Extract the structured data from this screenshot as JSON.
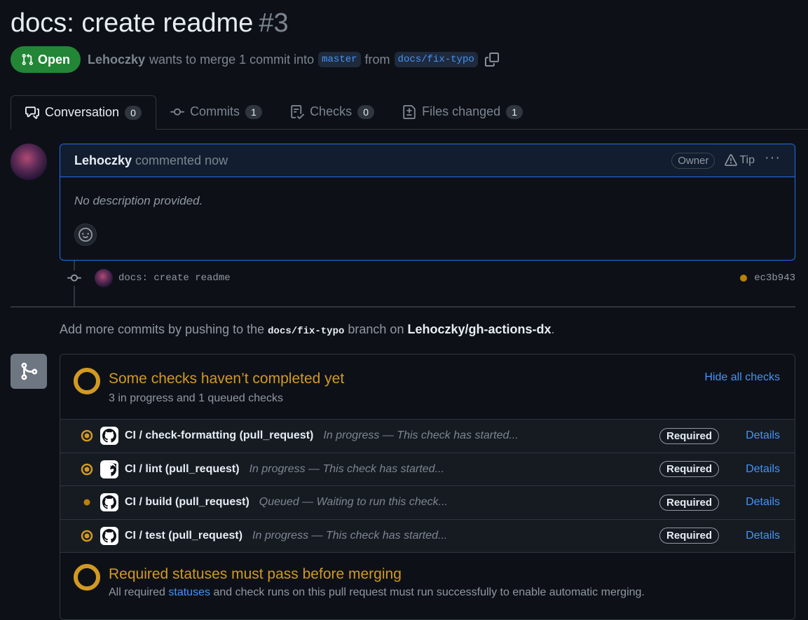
{
  "pr": {
    "title": "docs: create readme",
    "number": "#3",
    "state_label": "Open",
    "author": "Lehoczky",
    "merge_text": "wants to merge 1 commit into",
    "base_branch": "master",
    "from_text": "from",
    "head_branch": "docs/fix-typo"
  },
  "tabs": [
    {
      "label": "Conversation",
      "count": "0",
      "icon": "comment-discussion-icon"
    },
    {
      "label": "Commits",
      "count": "1",
      "icon": "git-commit-icon"
    },
    {
      "label": "Checks",
      "count": "0",
      "icon": "checklist-icon"
    },
    {
      "label": "Files changed",
      "count": "1",
      "icon": "file-diff-icon"
    }
  ],
  "comment": {
    "author": "Lehoczky",
    "action": "commented now",
    "role": "Owner",
    "tip": "Tip",
    "body": "No description provided."
  },
  "commit": {
    "message": "docs: create readme",
    "sha": "ec3b943"
  },
  "push_hint": {
    "prefix": "Add more commits by pushing to the",
    "branch": "docs/fix-typo",
    "middle": "branch on",
    "repo": "Lehoczky/gh-actions-dx",
    "suffix": "."
  },
  "checks": {
    "title": "Some checks haven’t completed yet",
    "subtitle": "3 in progress and 1 queued checks",
    "hide_label": "Hide all checks",
    "items": [
      {
        "name": "CI / check-formatting (pull_request)",
        "desc": "In progress — This check has started...",
        "status": "in_progress",
        "badge": "Required",
        "link": "Details"
      },
      {
        "name": "CI / lint (pull_request)",
        "desc": "In progress — This check has started...",
        "status": "in_progress",
        "badge": "Required",
        "link": "Details"
      },
      {
        "name": "CI / build (pull_request)",
        "desc": "Queued — Waiting to run this check...",
        "status": "queued",
        "badge": "Required",
        "link": "Details"
      },
      {
        "name": "CI / test (pull_request)",
        "desc": "In progress — This check has started...",
        "status": "in_progress",
        "badge": "Required",
        "link": "Details"
      }
    ]
  },
  "required": {
    "title": "Required statuses must pass before merging",
    "text_before": "All required",
    "link": "statuses",
    "text_after": "and check runs on this pull request must run successfully to enable automatic merging."
  },
  "colors": {
    "background": "#0d1117",
    "open_green": "#238636",
    "pending_amber": "#d29922",
    "link_blue": "#4493f8"
  }
}
